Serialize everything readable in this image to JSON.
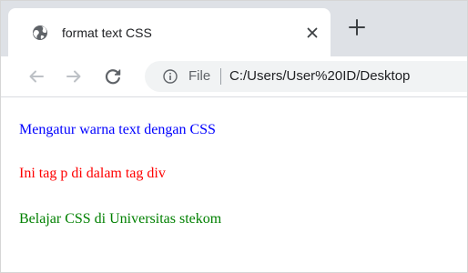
{
  "tab": {
    "title": "format text CSS",
    "favicon": "globe-icon",
    "close_icon": "close-icon",
    "new_tab_icon": "plus-icon"
  },
  "toolbar": {
    "back_icon": "arrow-left-icon",
    "forward_icon": "arrow-right-icon",
    "reload_icon": "reload-icon",
    "info_icon": "info-icon",
    "scheme_label": "File",
    "url": "C:/Users/User%20ID/Desktop"
  },
  "page": {
    "lines": [
      {
        "text": "Mengatur warna text dengan CSS",
        "color": "#0000ff"
      },
      {
        "text": "Ini tag p di dalam tag div",
        "color": "#ff0000"
      },
      {
        "text": "Belajar CSS di Universitas stekom",
        "color": "#008000"
      }
    ]
  }
}
